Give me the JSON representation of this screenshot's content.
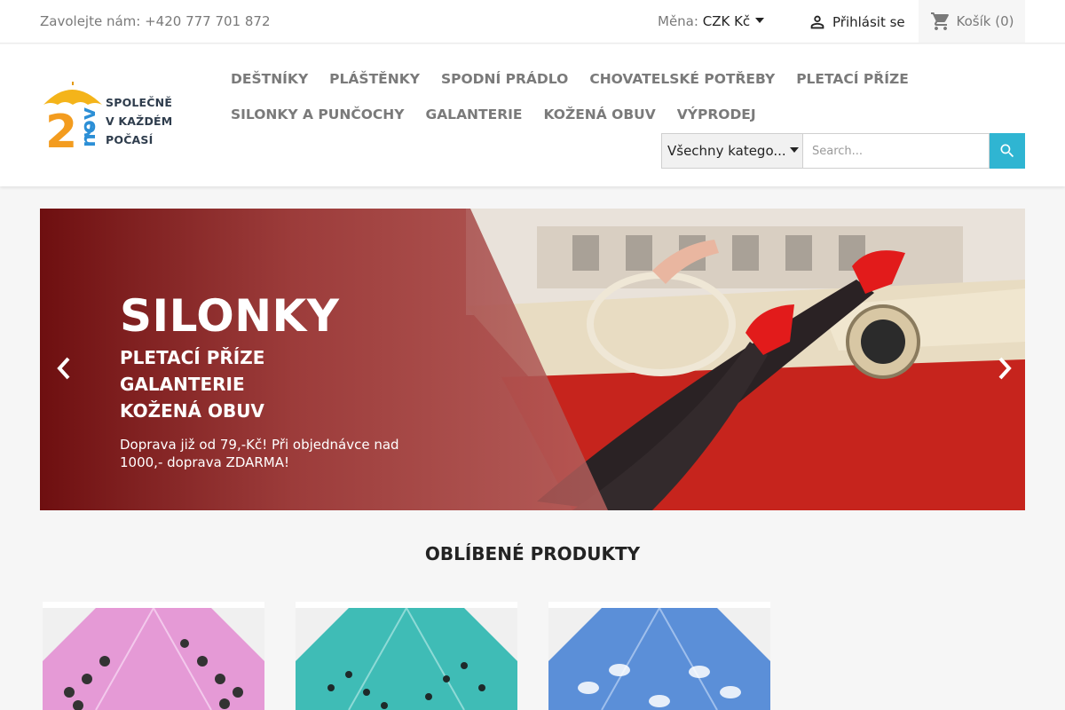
{
  "topbar": {
    "contact": "Zavolejte nám: +420 777 701 872",
    "currency_label": "Měna:",
    "currency_value": "CZK Kč",
    "signin": "Přihlásit se",
    "cart": "Košík (0)"
  },
  "logo": {
    "number": "2",
    "word": "nov",
    "line1": "SPOLEČNĚ",
    "line2": "V KAŽDÉM",
    "line3": "POČASÍ"
  },
  "nav": {
    "row1": [
      "Deštníky",
      "Pláštěnky",
      "Spodní prádlo",
      "Chovatelské potřeby",
      "Pletací příze"
    ],
    "row2": [
      "Silonky a punčochy",
      "Galanterie",
      "Kožená obuv",
      "Výprodej"
    ]
  },
  "search": {
    "category": "Všechny katego...",
    "placeholder": "Search..."
  },
  "slider": {
    "title": "SILONKY",
    "sub1": "PLETACÍ PŘÍZE",
    "sub2": "GALANTERIE",
    "sub3": "KOŽENÁ OBUV",
    "desc": "Doprava již od 79,-Kč! Při objednávce nad 1000,- doprava ZDARMA!"
  },
  "products": {
    "title": "OBLÍBENÉ PRODUKTY",
    "items": [
      {
        "name": "pink-umbrella",
        "color": "#e59ad6"
      },
      {
        "name": "teal-umbrella",
        "color": "#3fbcb6"
      },
      {
        "name": "blue-umbrella",
        "color": "#5b8fd8"
      }
    ]
  },
  "colors": {
    "accent": "#2fb5d2",
    "slide_overlay": "#8a1e1e"
  }
}
